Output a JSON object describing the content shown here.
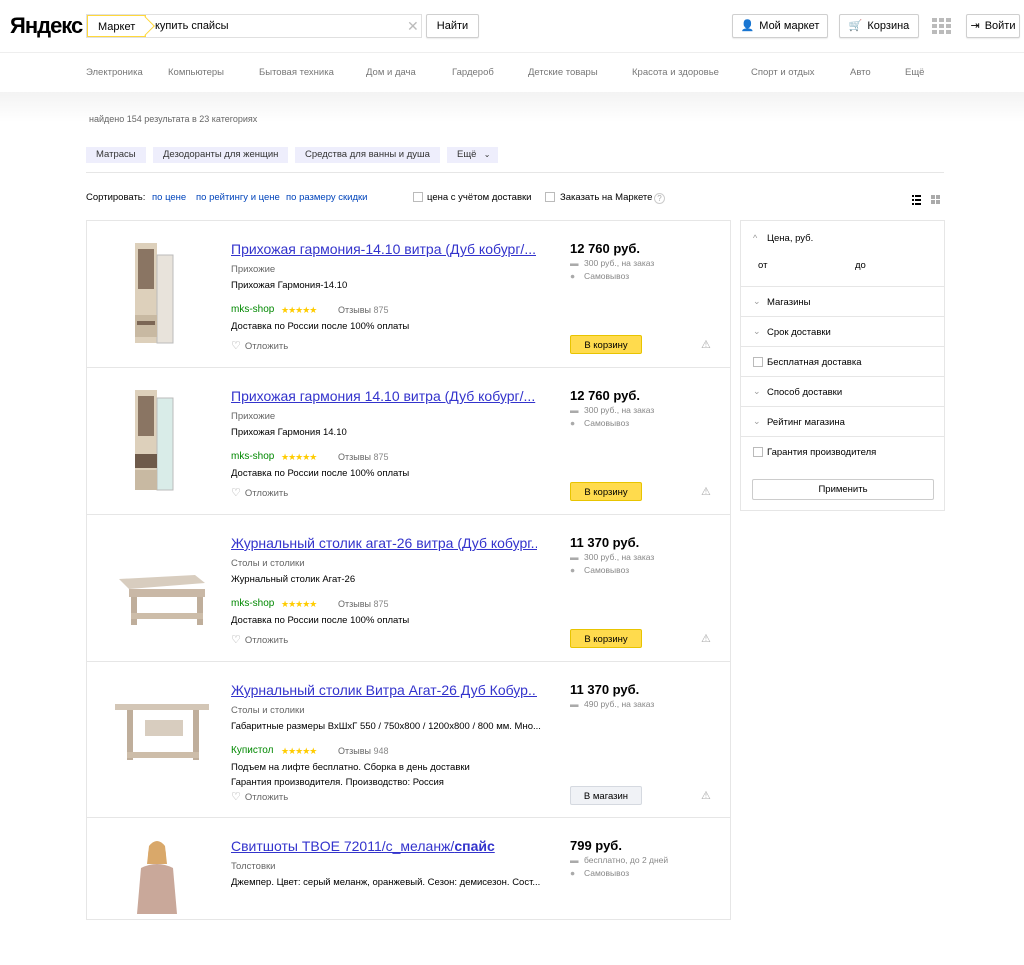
{
  "header": {
    "logo": "Яндекс",
    "market_tag": "Маркет",
    "search_value": "купить спайсы",
    "find_label": "Найти",
    "mymarket_label": "Мой маркет",
    "cart_label": "Корзина",
    "login_label": "Войти"
  },
  "nav": [
    "Электроника",
    "Компьютеры",
    "Бытовая техника",
    "Дом и дача",
    "Гардероб",
    "Детские товары",
    "Красота и здоровье",
    "Спорт и отдых",
    "Авто",
    "Ещё"
  ],
  "found_text": "найдено 154 результата в 23 категориях",
  "categories": [
    "Матрасы",
    "Дезодоранты для женщин",
    "Средства для ванны и душа",
    "Ещё"
  ],
  "sort": {
    "label": "Сортировать:",
    "by_price": "по цене",
    "by_rating": "по рейтингу и цене",
    "by_discount": "по размеру скидки",
    "with_delivery": "цена с учётом доставки",
    "order_on_market": "Заказать на Маркете"
  },
  "products": [
    {
      "title": "Прихожая гармония-14.10 витра (Дуб кобург/...",
      "category": "Прихожие",
      "desc": "Прихожая Гармония-14.10",
      "shop": "mks-shop",
      "stars": "★★★★★",
      "reviews_label": "Отзывы",
      "reviews_count": "875",
      "delivery": "Доставка по России после 100% оплаты",
      "delivery2": "",
      "postpone": "Отложить",
      "price": "12 760 руб.",
      "ship_cost": "300 руб., на заказ",
      "pickup": "Самовывоз",
      "action": "В корзину",
      "action_style": "yellow"
    },
    {
      "title": "Прихожая гармония 14.10 витра (Дуб кобург/...",
      "category": "Прихожие",
      "desc": "Прихожая Гармония 14.10",
      "shop": "mks-shop",
      "stars": "★★★★★",
      "reviews_label": "Отзывы",
      "reviews_count": "875",
      "delivery": "Доставка по России после 100% оплаты",
      "delivery2": "",
      "postpone": "Отложить",
      "price": "12 760 руб.",
      "ship_cost": "300 руб., на заказ",
      "pickup": "Самовывоз",
      "action": "В корзину",
      "action_style": "yellow"
    },
    {
      "title": "Журнальный столик агат-26 витра (Дуб кобург...",
      "category": "Столы и столики",
      "desc": "Журнальный столик Агат-26",
      "shop": "mks-shop",
      "stars": "★★★★★",
      "reviews_label": "Отзывы",
      "reviews_count": "875",
      "delivery": "Доставка по России после 100% оплаты",
      "delivery2": "",
      "postpone": "Отложить",
      "price": "11 370 руб.",
      "ship_cost": "300 руб., на заказ",
      "pickup": "Самовывоз",
      "action": "В корзину",
      "action_style": "yellow"
    },
    {
      "title": "Журнальный столик Витра Агат-26 Дуб Кобур...",
      "category": "Столы и столики",
      "desc": "Габаритные размеры ВхШхГ 550 / 750х800 / 1200х800 / 800 мм. Мно...",
      "shop": "Купистол",
      "stars": "★★★★★",
      "reviews_label": "Отзывы",
      "reviews_count": "948",
      "delivery": "Подъем на лифте бесплатно. Сборка в день доставки",
      "delivery2": "Гарантия производителя. Производство: Россия",
      "postpone": "Отложить",
      "price": "11 370 руб.",
      "ship_cost": "490 руб., на заказ",
      "pickup": "",
      "action": "В магазин",
      "action_style": "grey"
    },
    {
      "title": "Свитшоты TBOE 72011/с_меланж/",
      "title_bold": "спайс",
      "category": "Толстовки",
      "desc": "Джемпер. Цвет: серый меланж, оранжевый. Сезон: демисезон. Сост...",
      "shop": "",
      "stars": "",
      "reviews_label": "",
      "reviews_count": "",
      "delivery": "",
      "delivery2": "",
      "postpone": "",
      "price": "799 руб.",
      "ship_cost": "бесплатно, до 2 дней",
      "pickup": "Самовывоз",
      "action": "",
      "action_style": ""
    }
  ],
  "filters": {
    "price_label": "Цена, руб.",
    "from": "от",
    "to": "до",
    "shops": "Магазины",
    "delivery_time": "Срок доставки",
    "free_delivery": "Бесплатная доставка",
    "delivery_method": "Способ доставки",
    "shop_rating": "Рейтинг магазина",
    "warranty": "Гарантия производителя",
    "apply": "Применить"
  }
}
